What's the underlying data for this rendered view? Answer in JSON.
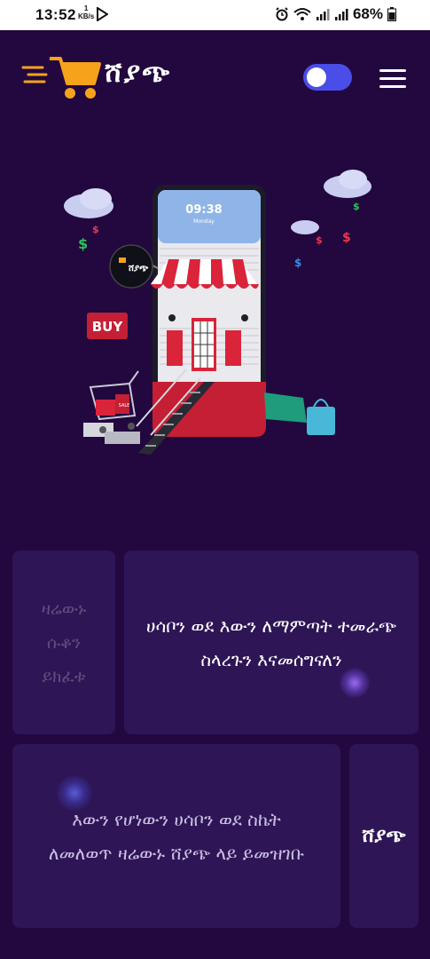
{
  "status_bar": {
    "time": "13:52",
    "net_speed": "1",
    "net_unit": "KB/s",
    "battery": "68%"
  },
  "header": {
    "brand_name": "ሸያጭ",
    "theme_toggle_on": true
  },
  "hero": {
    "phone_time": "09:38",
    "phone_day": "Monday",
    "sign_text": "ሸያጭ",
    "buy_label": "BUY",
    "cart_tag": "SALE"
  },
  "cards": [
    {
      "text": "ዛሬውኑ ሱቆን ይክፈቱ"
    },
    {
      "text": "ሀሳቦን ወደ እውን ለማምጣት ተመራጭ ስላረጉን እናመሰግናለን"
    },
    {
      "text": "እውን የሆነውን ሀሳቦን ወደ ስኬት ለመለወጥ ዛሬውኑ ሸያጭ ላይ ይመዝገቡ"
    },
    {
      "text": "ሸያጭ"
    }
  ],
  "colors": {
    "background": "#22083f",
    "card": "#2e1556",
    "accent_orange": "#f7a21b",
    "toggle": "#4a4de8"
  }
}
